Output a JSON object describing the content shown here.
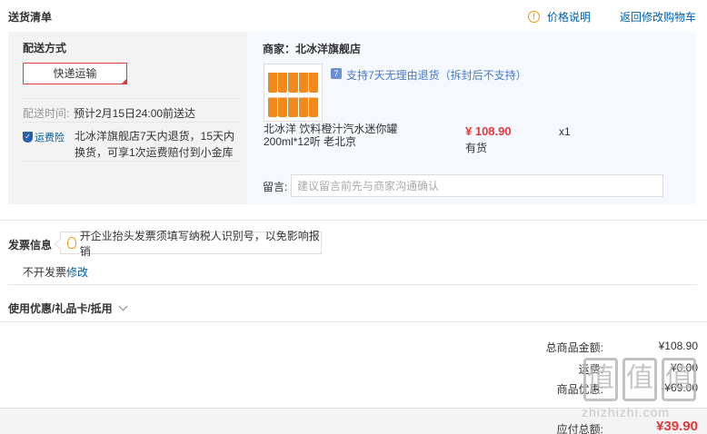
{
  "header": {
    "title": "送货清单",
    "price_note_label": "价格说明",
    "back_label": "返回修改购物车"
  },
  "shipping": {
    "title": "配送方式",
    "method_button": "快递运输",
    "time_label": "配送时间:",
    "time_value": "预计2月15日24:00前送达",
    "insure_label": "运费险",
    "insure_text": "北冰洋旗舰店7天内退货，15天内换货，可享1次运费赔付到小金库"
  },
  "merchant": {
    "label": "商家：北冰洋旗舰店",
    "return_badge": "7",
    "return_policy": "支持7天无理由退货（拆封后不支持）",
    "product": {
      "name": "北冰洋 饮料橙汁汽水迷你罐200ml*12听 老北京",
      "price": "¥ 108.90",
      "stock": "有货",
      "qty": "x1"
    },
    "message_label": "留言:",
    "message_placeholder": "建议留言前先与商家沟通确认"
  },
  "invoice": {
    "title": "发票信息",
    "tip": "开企业抬头发票须填写纳税人识别号，以免影响报销",
    "value": "不开发票",
    "edit_label": "修改"
  },
  "coupon": {
    "label": "使用优惠/礼品卡/抵用"
  },
  "summary": {
    "rows": [
      {
        "label": "总商品金额:",
        "value": "¥108.90"
      },
      {
        "label": "运费:",
        "value": "¥0.00"
      },
      {
        "label": "商品优惠:",
        "value": "-¥69.00"
      }
    ],
    "pay_label": "应付总额:",
    "pay_value": "¥39.90"
  },
  "watermark": {
    "text": "zhizhizhi.com"
  },
  "colors": {
    "accent_red": "#e4393c",
    "link_blue": "#005ea7",
    "warning_orange": "#f39800"
  }
}
